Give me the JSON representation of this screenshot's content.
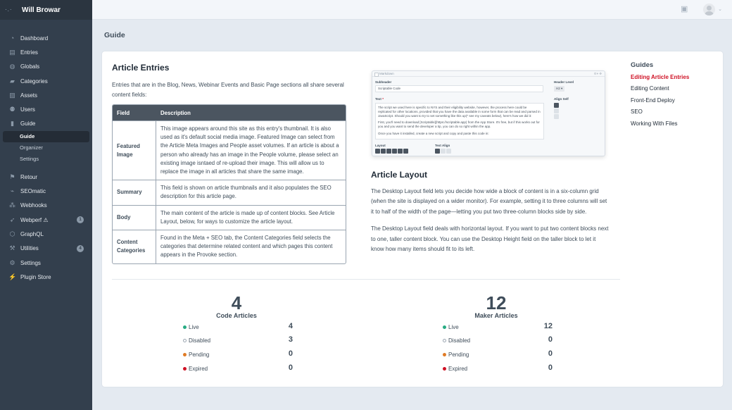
{
  "sidebar": {
    "site_name": "Will Browar",
    "items": [
      {
        "label": "Dashboard",
        "icon": "dashboard-icon",
        "glyph": "◔"
      },
      {
        "label": "Entries",
        "icon": "entries-icon",
        "glyph": "▤"
      },
      {
        "label": "Globals",
        "icon": "globe-icon",
        "glyph": "◍"
      },
      {
        "label": "Categories",
        "icon": "folder-icon",
        "glyph": "▰"
      },
      {
        "label": "Assets",
        "icon": "image-icon",
        "glyph": "▨"
      },
      {
        "label": "Users",
        "icon": "users-icon",
        "glyph": "⚉"
      },
      {
        "label": "Guide",
        "icon": "book-icon",
        "glyph": "▮"
      }
    ],
    "sub_items": [
      {
        "label": "Guide",
        "active": true
      },
      {
        "label": "Organizer"
      },
      {
        "label": "Settings"
      }
    ],
    "items2": [
      {
        "label": "Retour",
        "icon": "flag-icon",
        "glyph": "⚑"
      },
      {
        "label": "SEOmatic",
        "icon": "seo-icon",
        "glyph": "⌁"
      },
      {
        "label": "Webhooks",
        "icon": "webhooks-icon",
        "glyph": "⁂"
      },
      {
        "label": "Webperf ⚠",
        "icon": "rocket-icon",
        "glyph": "➶",
        "badge": "1"
      },
      {
        "label": "GraphQL",
        "icon": "graphql-icon",
        "glyph": "⬡"
      },
      {
        "label": "Utilities",
        "icon": "wrench-icon",
        "glyph": "⚒",
        "badge": "4"
      },
      {
        "label": "Settings",
        "icon": "gear-icon",
        "glyph": "⚙"
      },
      {
        "label": "Plugin Store",
        "icon": "plug-icon",
        "glyph": "⚡"
      }
    ]
  },
  "topbar": {
    "gift_glyph": "🎁",
    "caret": "⌄"
  },
  "page": {
    "title": "Guide"
  },
  "article_entries": {
    "heading": "Article Entries",
    "intro": "Entries that are in the Blog, News, Webinar Events and Basic Page sections all share several content fields:",
    "table": {
      "headers": [
        "Field",
        "Description"
      ],
      "rows": [
        {
          "field": "Featured Image",
          "description": "This image appears around this site as this entry's thumbnail. It is also used as it's default social media image. Featured Image can select from the Article Meta Images and People asset volumes. If an article is about a person who already has an image in the People volume, please select an existing image isntaed of re-upload their image. This will allow us to replace the image in all articles that share the same image."
        },
        {
          "field": "Summary",
          "description": "This field is shown on article thumbnails and it also populates the SEO description for this article page."
        },
        {
          "field": "Body",
          "description": "The main content of the article is made up of content blocks. See Article Layout, below, for ways to customize the article layout."
        },
        {
          "field": "Content Categories",
          "description": "Found in the Meta + SEO tab, the Content Categories field selects the categories that determine related content and which pages this content appears in the Provoke section."
        }
      ]
    }
  },
  "screenshot": {
    "block_type": "Markdown",
    "tools": "⚙▾ ✥",
    "subheader_label": "Subheader",
    "subheader_value": "Scriptable Code",
    "header_level_label": "Header Level",
    "header_level_value": "H2 ▾",
    "text_label": "Text",
    "required": "*",
    "text_lines": [
      "The script we used here is specific to NYS and their eligibility website, however, the process here could be replicated for other locations, provided that you have the data available in some form that can be read and parsed in JavaScript. Should you want to try to set something like this up(* see my caveats below), here's how we did it:",
      "First, you'll need to download [Scriptable](https://scriptable.app) from the App Store. It's free, but if this works out for you and you want to send the developer a tip, you can do so right within the app.",
      "Once you have it installed, create a new script and copy and paste this code in:"
    ],
    "align_self_label": "Align Self",
    "layout_label": "Layout",
    "text_align_label": "Text Align"
  },
  "article_layout": {
    "heading": "Article Layout",
    "paragraphs": [
      "The Desktop Layout field lets you decide how wide a block of content is in a six-column grid (when the site is displayed on a wider monitor). For example, setting it to three columns will set it to half of the width of the page—letting you put two three-column blocks side by side.",
      "The Desktop Layout field deals with horizontal layout. If you want to put two content blocks next to one, taller content block. You can use the Desktop Height field on the taller block to let it know how many items should fit to its left."
    ]
  },
  "guides": {
    "heading": "Guides",
    "links": [
      {
        "label": "Editing Article Entries",
        "active": true
      },
      {
        "label": "Editing Content"
      },
      {
        "label": "Front-End Deploy"
      },
      {
        "label": "SEO"
      },
      {
        "label": "Working With Files"
      }
    ]
  },
  "stats": [
    {
      "total": "4",
      "title": "Code Articles",
      "rows": [
        {
          "label": "Live",
          "value": "4",
          "color": "#27ab83",
          "hollow": false
        },
        {
          "label": "Disabled",
          "value": "3",
          "color": "#9aa5b1",
          "hollow": true
        },
        {
          "label": "Pending",
          "value": "0",
          "color": "#e07b25",
          "hollow": false
        },
        {
          "label": "Expired",
          "value": "0",
          "color": "#cf1124",
          "hollow": false
        }
      ]
    },
    {
      "total": "12",
      "title": "Maker Articles",
      "rows": [
        {
          "label": "Live",
          "value": "12",
          "color": "#27ab83",
          "hollow": false
        },
        {
          "label": "Disabled",
          "value": "0",
          "color": "#9aa5b1",
          "hollow": true
        },
        {
          "label": "Pending",
          "value": "0",
          "color": "#e07b25",
          "hollow": false
        },
        {
          "label": "Expired",
          "value": "0",
          "color": "#cf1124",
          "hollow": false
        }
      ]
    }
  ]
}
